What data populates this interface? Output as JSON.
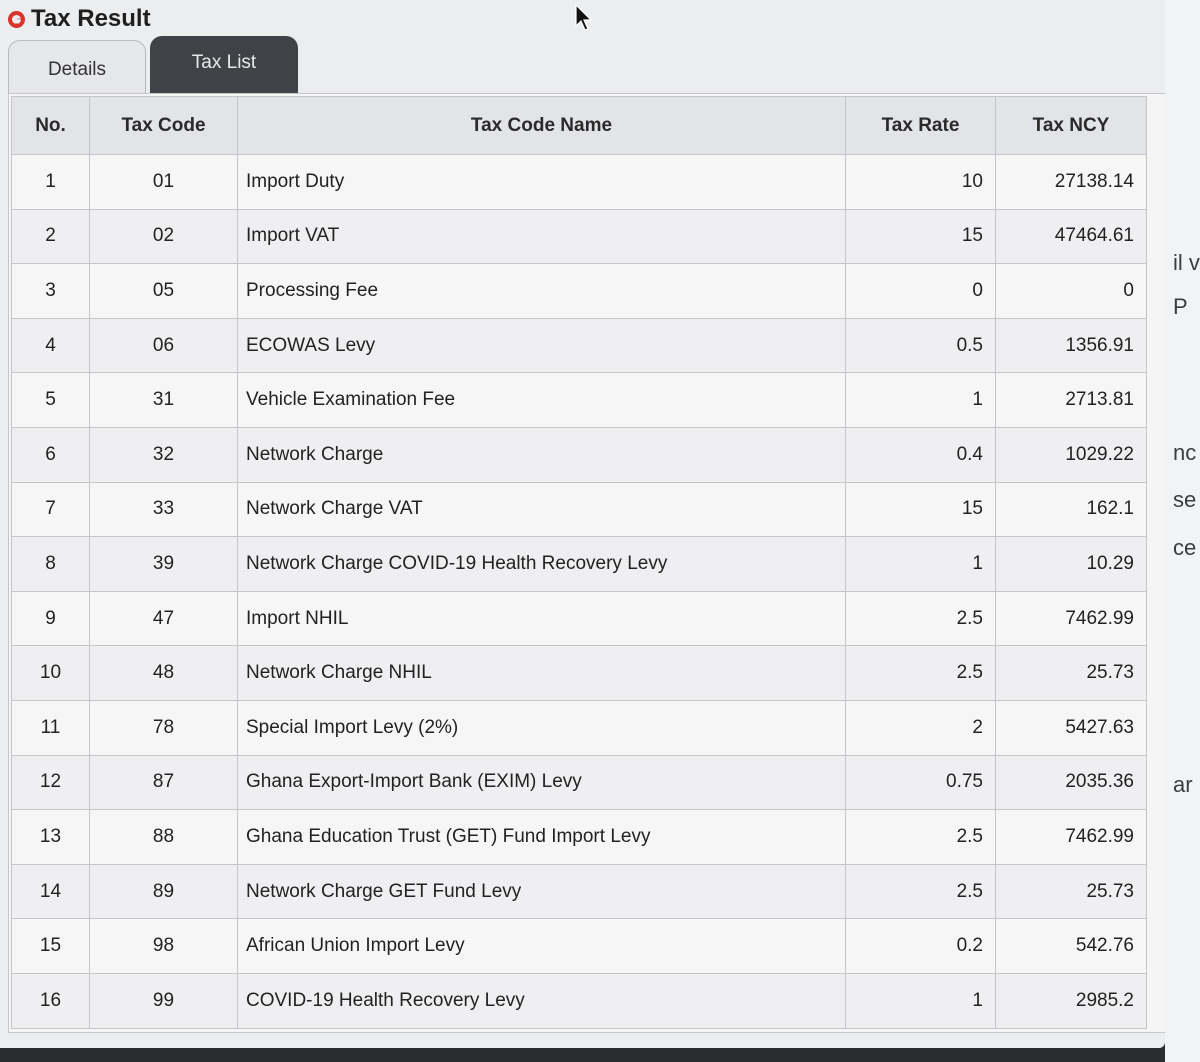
{
  "header": {
    "title": "Tax Result"
  },
  "tabs": [
    {
      "label": "Details",
      "active": false
    },
    {
      "label": "Tax List",
      "active": true
    }
  ],
  "table": {
    "columns": [
      "No.",
      "Tax Code",
      "Tax Code Name",
      "Tax Rate",
      "Tax NCY"
    ],
    "rows": [
      {
        "no": "1",
        "code": "01",
        "name": "Import Duty",
        "rate": "10",
        "amount": "27138.14"
      },
      {
        "no": "2",
        "code": "02",
        "name": "Import VAT",
        "rate": "15",
        "amount": "47464.61"
      },
      {
        "no": "3",
        "code": "05",
        "name": "Processing Fee",
        "rate": "0",
        "amount": "0"
      },
      {
        "no": "4",
        "code": "06",
        "name": "ECOWAS Levy",
        "rate": "0.5",
        "amount": "1356.91"
      },
      {
        "no": "5",
        "code": "31",
        "name": "Vehicle Examination Fee",
        "rate": "1",
        "amount": "2713.81"
      },
      {
        "no": "6",
        "code": "32",
        "name": "Network Charge",
        "rate": "0.4",
        "amount": "1029.22"
      },
      {
        "no": "7",
        "code": "33",
        "name": "Network Charge VAT",
        "rate": "15",
        "amount": "162.1"
      },
      {
        "no": "8",
        "code": "39",
        "name": "Network Charge COVID-19 Health Recovery Levy",
        "rate": "1",
        "amount": "10.29"
      },
      {
        "no": "9",
        "code": "47",
        "name": "Import NHIL",
        "rate": "2.5",
        "amount": "7462.99"
      },
      {
        "no": "10",
        "code": "48",
        "name": "Network Charge NHIL",
        "rate": "2.5",
        "amount": "25.73"
      },
      {
        "no": "11",
        "code": "78",
        "name": "Special Import Levy (2%)",
        "rate": "2",
        "amount": "5427.63"
      },
      {
        "no": "12",
        "code": "87",
        "name": "Ghana Export-Import Bank (EXIM) Levy",
        "rate": "0.75",
        "amount": "2035.36"
      },
      {
        "no": "13",
        "code": "88",
        "name": "Ghana Education Trust (GET) Fund Import Levy",
        "rate": "2.5",
        "amount": "7462.99"
      },
      {
        "no": "14",
        "code": "89",
        "name": "Network Charge GET Fund Levy",
        "rate": "2.5",
        "amount": "25.73"
      },
      {
        "no": "15",
        "code": "98",
        "name": "African Union Import Levy",
        "rate": "0.2",
        "amount": "542.76"
      },
      {
        "no": "16",
        "code": "99",
        "name": "COVID-19 Health Recovery Levy",
        "rate": "1",
        "amount": "2985.2"
      }
    ]
  },
  "side_fragments": [
    "il v",
    "P",
    "nc",
    "se",
    "ce",
    "ar"
  ],
  "colors": {
    "logo": "#d9342b",
    "active_tab": "#3f4247",
    "panel": "#ecedef"
  }
}
